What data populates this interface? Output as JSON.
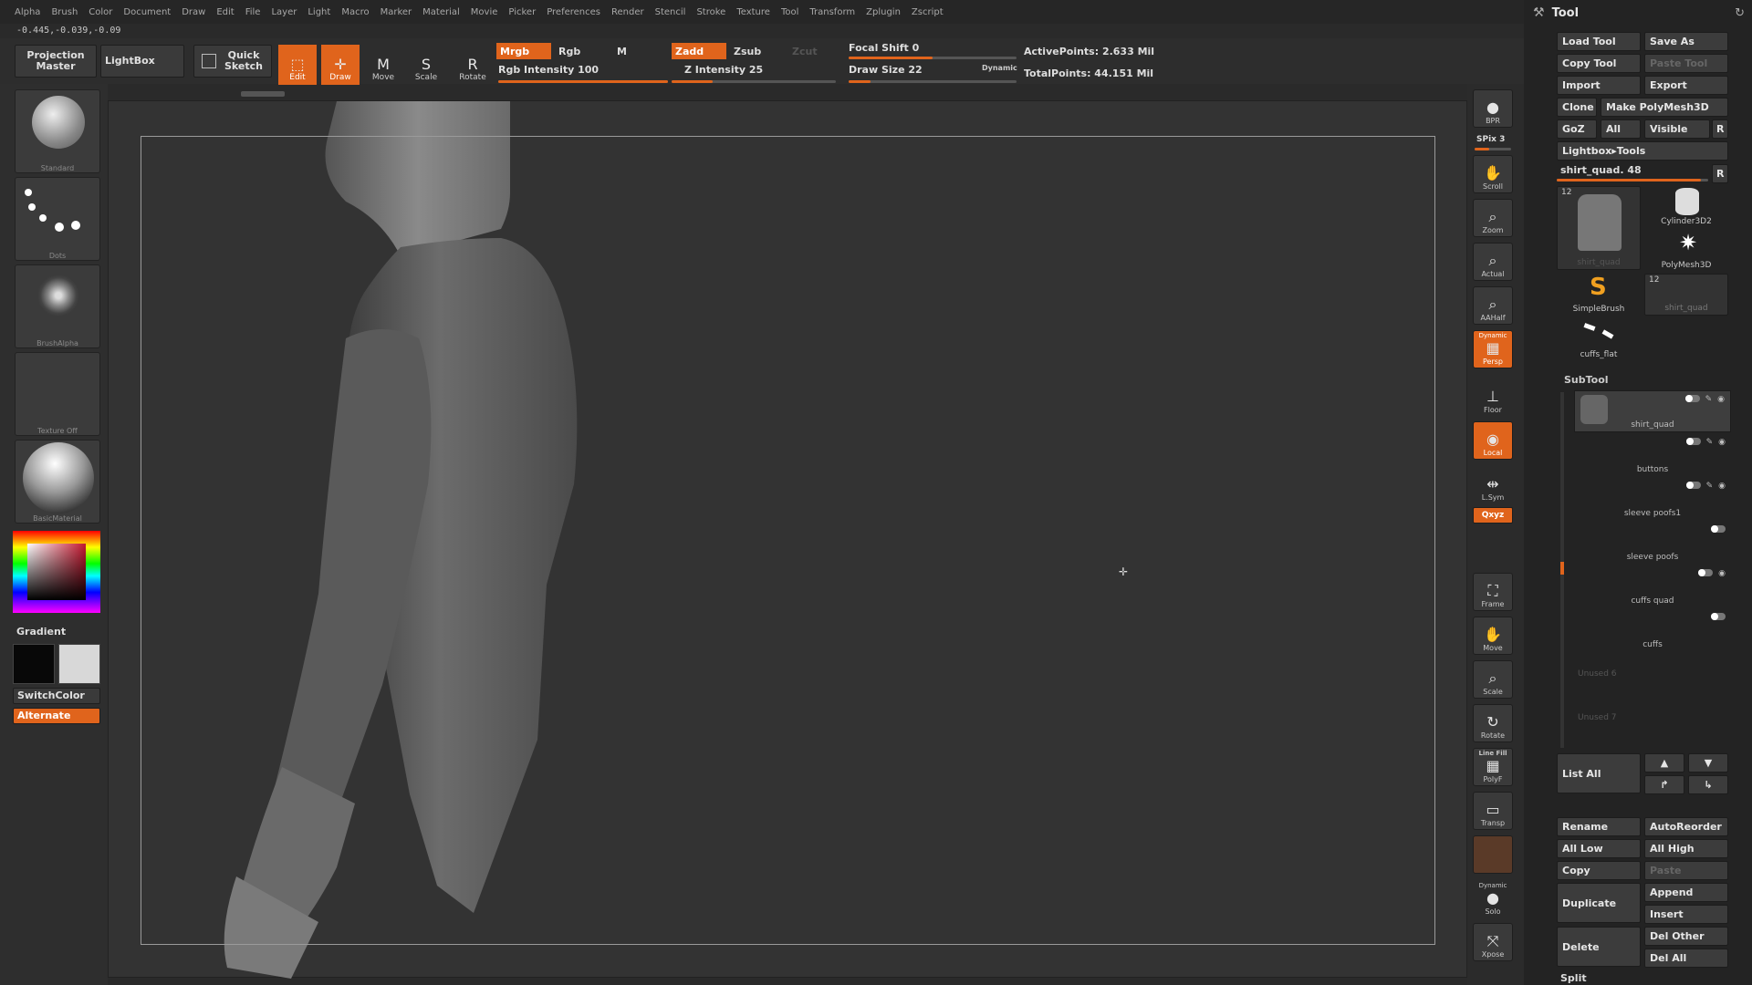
{
  "menu": [
    "Alpha",
    "Brush",
    "Color",
    "Document",
    "Draw",
    "Edit",
    "File",
    "Layer",
    "Light",
    "Macro",
    "Marker",
    "Material",
    "Movie",
    "Picker",
    "Preferences",
    "Render",
    "Stencil",
    "Stroke",
    "Texture",
    "Tool",
    "Transform",
    "Zplugin",
    "Zscript"
  ],
  "coords": "-0.445,-0.039,-0.09",
  "top": {
    "projection_master": "Projection Master",
    "lightbox": "LightBox",
    "quick_sketch": "Quick Sketch",
    "edit": "Edit",
    "draw": "Draw",
    "move": "Move",
    "scale": "Scale",
    "rotate": "Rotate",
    "mrgb": "Mrgb",
    "rgb": "Rgb",
    "m": "M",
    "rgb_intensity": "Rgb Intensity 100",
    "zadd": "Zadd",
    "zsub": "Zsub",
    "zcut": "Zcut",
    "z_intensity": "Z Intensity 25",
    "focal_shift": "Focal Shift 0",
    "draw_size": "Draw Size 22",
    "dynamic": "Dynamic",
    "active_points": "ActivePoints: 2.633 Mil",
    "total_points": "TotalPoints: 44.151 Mil",
    "rgb_intensity_value": 100,
    "z_intensity_value": 25,
    "focal_shift_value": 0,
    "draw_size_value": 22
  },
  "left": {
    "standard": "Standard",
    "dots": "Dots",
    "brush_alpha": "BrushAlpha",
    "texture_off": "Texture Off",
    "material": "BasicMaterial",
    "gradient": "Gradient",
    "switch_color": "SwitchColor",
    "alternate": "Alternate"
  },
  "right": {
    "bpr": "BPR",
    "spix": "SPix 3",
    "scroll": "Scroll",
    "zoom": "Zoom",
    "actual": "Actual",
    "aahalf": "AAHalf",
    "dynamic": "Dynamic",
    "persp": "Persp",
    "floor": "Floor",
    "local": "Local",
    "lsym": "L.Sym",
    "xyz": "Qxyz",
    "frame": "Frame",
    "move": "Move",
    "scale": "Scale",
    "rotate": "Rotate",
    "line_fill": "Line Fill",
    "polyf": "PolyF",
    "transp": "Transp",
    "dynamic2": "Dynamic",
    "solo": "Solo",
    "xpose": "Xpose"
  },
  "tool": {
    "title": "Tool",
    "load": "Load Tool",
    "save_as": "Save As",
    "copy": "Copy Tool",
    "paste": "Paste Tool",
    "import": "Import",
    "export": "Export",
    "clone": "Clone",
    "make_poly": "Make PolyMesh3D",
    "goz": "GoZ",
    "all": "All",
    "visible": "Visible",
    "r": "R",
    "lightbox_tools": "Lightbox▸Tools",
    "current": "shirt_quad. 48",
    "r2": "R",
    "items": [
      {
        "num": "12",
        "name": "shirt_quad"
      },
      {
        "num": "",
        "name": "Cylinder3D2"
      },
      {
        "num": "",
        "name": "PolyMesh3D"
      },
      {
        "num": "",
        "name": "SimpleBrush"
      },
      {
        "num": "12",
        "name": "shirt_quad"
      },
      {
        "num": "",
        "name": "cuffs_flat"
      }
    ]
  },
  "subtool": {
    "title": "SubTool",
    "rows": [
      "shirt_quad",
      "buttons",
      "sleeve poofs1",
      "sleeve poofs",
      "cuffs quad",
      "cuffs",
      "Unused 6",
      "Unused 7"
    ],
    "list_all": "List All",
    "rename": "Rename",
    "autoreorder": "AutoReorder",
    "all_low": "All Low",
    "all_high": "All High",
    "copy": "Copy",
    "paste": "Paste",
    "duplicate": "Duplicate",
    "append": "Append",
    "insert": "Insert",
    "delete": "Delete",
    "del_other": "Del Other",
    "del_all": "Del All",
    "split": "Split"
  },
  "colors": {
    "accent": "#e0641c",
    "bg": "#2a2a2a",
    "panel": "#232323"
  }
}
